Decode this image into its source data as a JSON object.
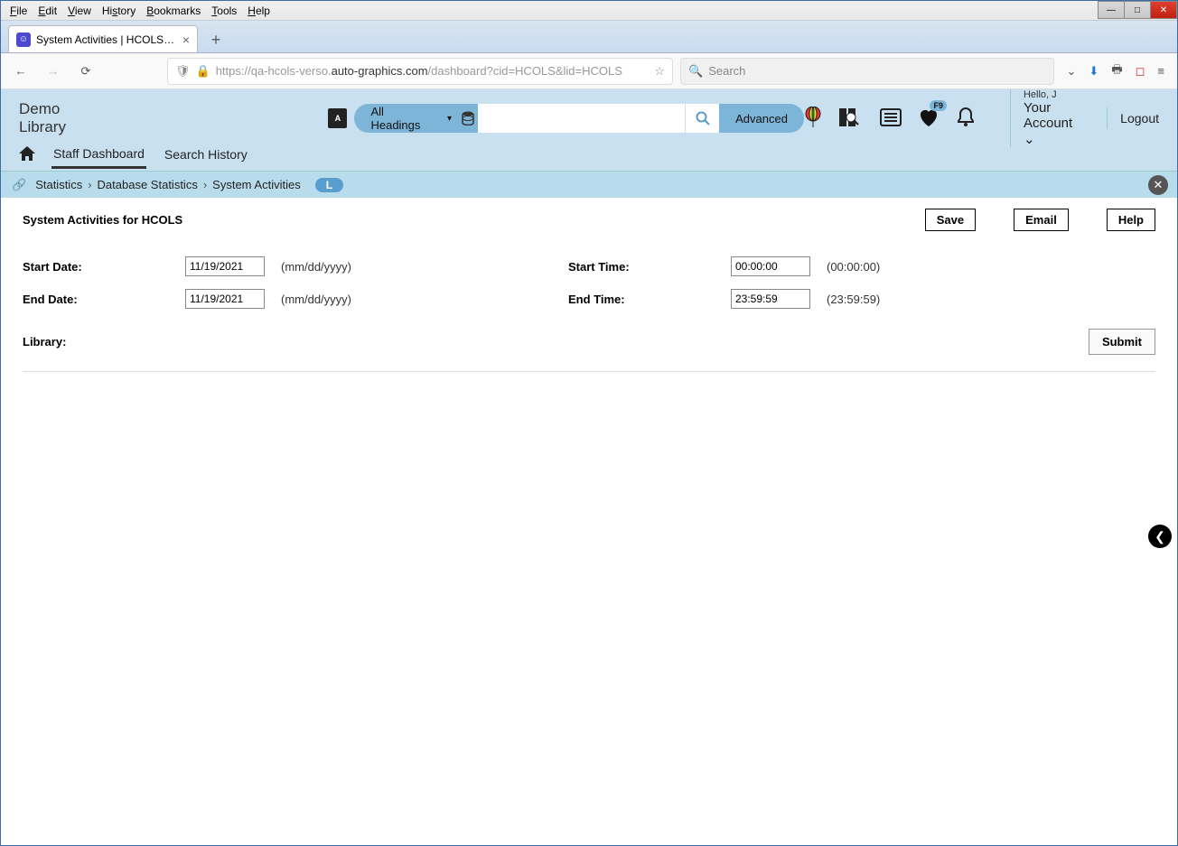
{
  "browser": {
    "menus": [
      "File",
      "Edit",
      "View",
      "History",
      "Bookmarks",
      "Tools",
      "Help"
    ],
    "tab_title": "System Activities | HCOLS | hco",
    "url_prefix": "https://qa-hcols-verso.",
    "url_dark": "auto-graphics.com",
    "url_suffix": "/dashboard?cid=HCOLS&lid=HCOLS",
    "search_placeholder": "Search"
  },
  "header": {
    "library_name": "Demo Library",
    "headings_label": "All Headings",
    "advanced_label": "Advanced",
    "heart_badge": "F9",
    "hello": "Hello, J",
    "account": "Your Account",
    "logout": "Logout"
  },
  "nav": {
    "staff_dashboard": "Staff Dashboard",
    "search_history": "Search History"
  },
  "breadcrumb": {
    "level1": "Statistics",
    "level2": "Database Statistics",
    "level3": "System Activities",
    "pill": "L"
  },
  "page": {
    "title": "System Activities for HCOLS",
    "save": "Save",
    "email": "Email",
    "help": "Help",
    "start_date_label": "Start Date:",
    "start_date_value": "11/19/2021",
    "date_hint": "(mm/dd/yyyy)",
    "end_date_label": "End Date:",
    "end_date_value": "11/19/2021",
    "start_time_label": "Start Time:",
    "start_time_value": "00:00:00",
    "start_time_hint": "(00:00:00)",
    "end_time_label": "End Time:",
    "end_time_value": "23:59:59",
    "end_time_hint": "(23:59:59)",
    "library_label": "Library:",
    "submit": "Submit"
  }
}
